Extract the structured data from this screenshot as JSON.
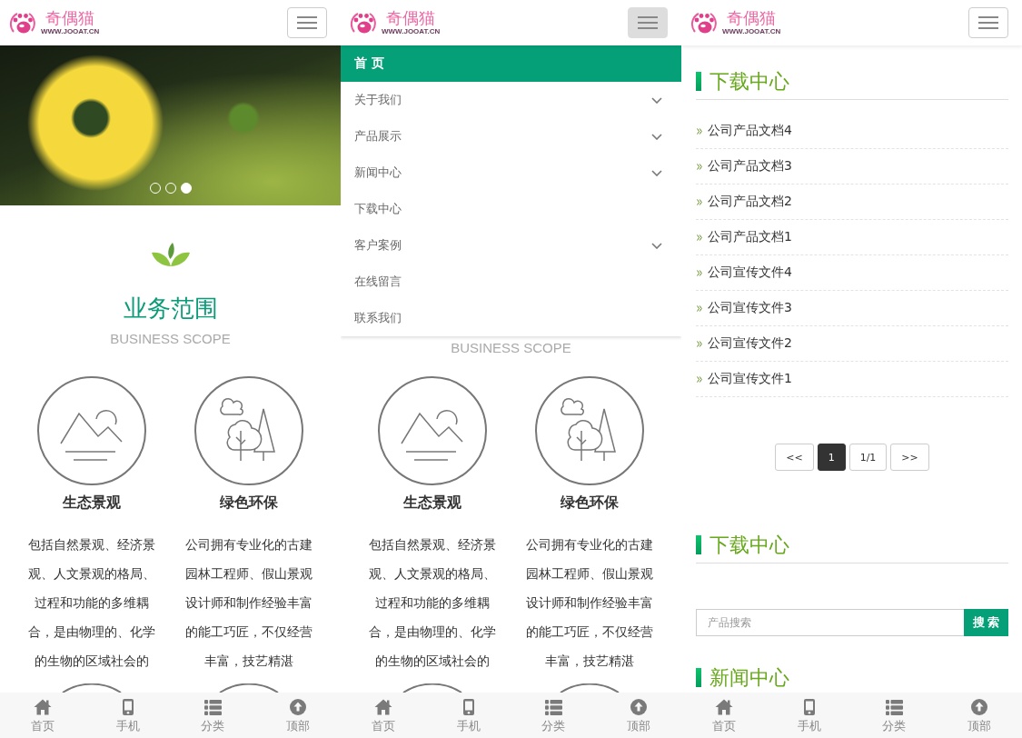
{
  "screens": [
    {
      "kind": "home",
      "header": {
        "logo_name": "奇偶猫",
        "logo_url": "WWW.JOOAT.CN",
        "menu_expanded": false
      },
      "banner": {
        "dots": [
          {
            "selected": false
          },
          {
            "selected": false
          },
          {
            "selected": true
          }
        ]
      },
      "intro": {
        "title": "业务范围",
        "subtitle": "BUSINESS SCOPE"
      },
      "services": [
        {
          "kind": "landscape",
          "title": "生态景观",
          "text": "包括自然景观、经济景观、人文景观的格局、过程和功能的多维耦合，是由物理的、化学的生物的区域社会的"
        },
        {
          "kind": "trees",
          "title": "绿色环保",
          "text": "公司拥有专业化的古建园林工程师、假山景观设计师和制作经验丰富的能工巧匠，不仅经营丰富，技艺精湛"
        }
      ],
      "bottom_nav": [
        {
          "kind": "home",
          "label": "首页"
        },
        {
          "kind": "phone",
          "label": "手机"
        },
        {
          "kind": "list",
          "label": "分类"
        },
        {
          "kind": "top",
          "label": "顶部"
        }
      ]
    },
    {
      "kind": "home",
      "header": {
        "logo_name": "奇偶猫",
        "logo_url": "WWW.JOOAT.CN",
        "menu_expanded": true
      },
      "menu": [
        {
          "label": "首 页",
          "selected": true,
          "has_submenu": false
        },
        {
          "label": "关于我们",
          "selected": false,
          "has_submenu": true
        },
        {
          "label": "产品展示",
          "selected": false,
          "has_submenu": true
        },
        {
          "label": "新闻中心",
          "selected": false,
          "has_submenu": true
        },
        {
          "label": "下载中心",
          "selected": false,
          "has_submenu": false
        },
        {
          "label": "客户案例",
          "selected": false,
          "has_submenu": true
        },
        {
          "label": "在线留言",
          "selected": false,
          "has_submenu": false
        },
        {
          "label": "联系我们",
          "selected": false,
          "has_submenu": false
        }
      ],
      "intro": {
        "subtitle": "BUSINESS SCOPE"
      },
      "services": [
        {
          "kind": "landscape",
          "title": "生态景观",
          "text": "包括自然景观、经济景观、人文景观的格局、过程和功能的多维耦合，是由物理的、化学的生物的区域社会的"
        },
        {
          "kind": "trees",
          "title": "绿色环保",
          "text": "公司拥有专业化的古建园林工程师、假山景观设计师和制作经验丰富的能工巧匠，不仅经营丰富，技艺精湛"
        }
      ],
      "bottom_nav": [
        {
          "kind": "home",
          "label": "首页"
        },
        {
          "kind": "phone",
          "label": "手机"
        },
        {
          "kind": "list",
          "label": "分类"
        },
        {
          "kind": "top",
          "label": "顶部"
        }
      ]
    },
    {
      "kind": "download",
      "header": {
        "logo_name": "奇偶猫",
        "logo_url": "WWW.JOOAT.CN",
        "menu_expanded": false
      },
      "blocks": [
        {
          "kind": "list",
          "heading": "下载中心",
          "items": [
            "公司产品文档4",
            "公司产品文档3",
            "公司产品文档2",
            "公司产品文档1",
            "公司宣传文件4",
            "公司宣传文件3",
            "公司宣传文件2",
            "公司宣传文件1"
          ],
          "pagination": [
            {
              "label": "<<",
              "selected": false
            },
            {
              "label": "1",
              "selected": true
            },
            {
              "label": "1/1",
              "selected": false
            },
            {
              "label": ">>",
              "selected": false
            }
          ]
        },
        {
          "kind": "search",
          "heading": "下载中心",
          "placeholder": "产品搜索",
          "button": "搜 索"
        },
        {
          "kind": "heading",
          "heading": "新闻中心"
        }
      ],
      "bottom_nav": [
        {
          "kind": "home",
          "label": "首页"
        },
        {
          "kind": "phone",
          "label": "手机"
        },
        {
          "kind": "list",
          "label": "分类"
        },
        {
          "kind": "top",
          "label": "顶部"
        }
      ]
    }
  ]
}
